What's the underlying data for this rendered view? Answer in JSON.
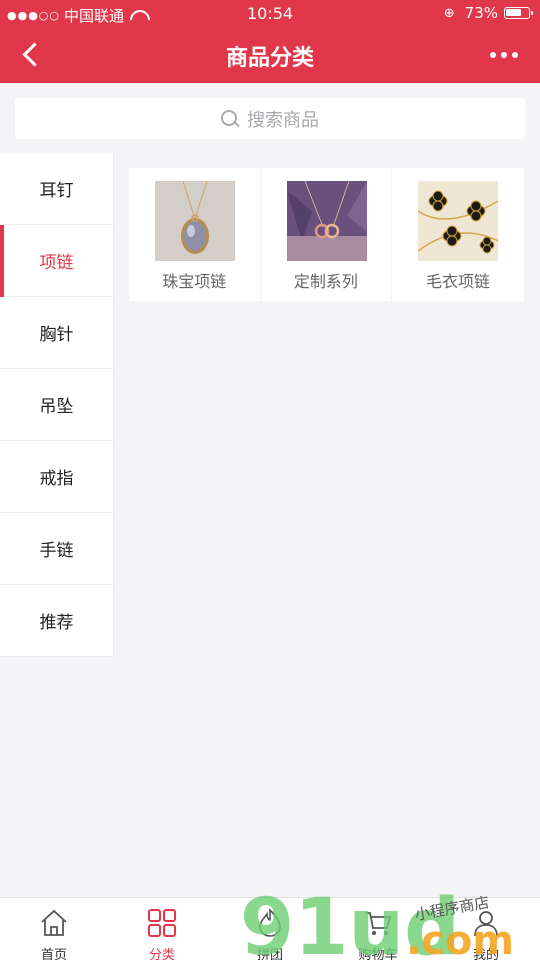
{
  "status": {
    "carrier": "中国联通",
    "signal": "●●●○○",
    "time": "10:54",
    "battery": "73%",
    "battery_level": 0.73
  },
  "nav": {
    "title": "商品分类",
    "back_icon": "chevron-left-icon",
    "more_icon": "more-dots-icon"
  },
  "search": {
    "placeholder": "搜索商品"
  },
  "sidebar": {
    "items": [
      {
        "label": "耳钉"
      },
      {
        "label": "项链",
        "active": true
      },
      {
        "label": "胸针"
      },
      {
        "label": "吊坠"
      },
      {
        "label": "戒指"
      },
      {
        "label": "手链"
      },
      {
        "label": "推荐"
      }
    ]
  },
  "subcategories": [
    {
      "label": "珠宝项链"
    },
    {
      "label": "定制系列"
    },
    {
      "label": "毛衣项链"
    }
  ],
  "tabbar": {
    "tabs": [
      {
        "label": "首页",
        "icon": "home-icon"
      },
      {
        "label": "分类",
        "icon": "grid-icon",
        "active": true
      },
      {
        "label": "拼团",
        "icon": "hot-icon"
      },
      {
        "label": "购物车",
        "icon": "cart-icon"
      },
      {
        "label": "我的",
        "icon": "user-icon"
      }
    ]
  },
  "watermark": {
    "main": "91ud",
    "domain": ".com",
    "slogan": "小程序商店"
  },
  "colors": {
    "brand": "#e1374a",
    "background": "#f4f4f6"
  }
}
